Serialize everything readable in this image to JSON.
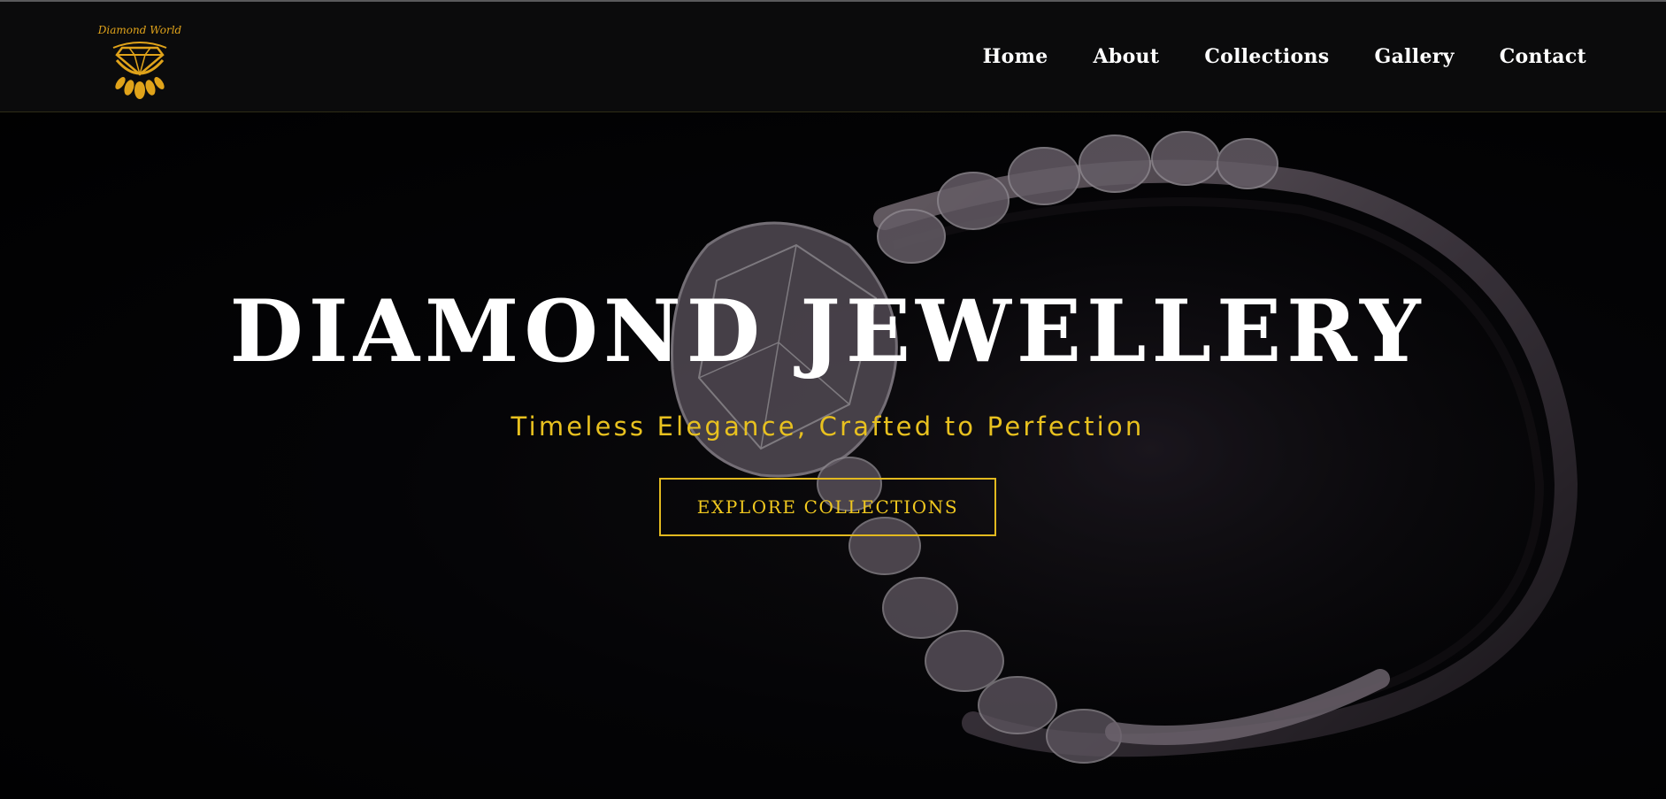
{
  "brand": {
    "logo_text": "Diamond World",
    "logo_icon": "diamond-lotus-icon",
    "logo_color": "#e0a31a"
  },
  "nav": {
    "items": [
      {
        "label": "Home"
      },
      {
        "label": "About"
      },
      {
        "label": "Collections"
      },
      {
        "label": "Gallery"
      },
      {
        "label": "Contact"
      }
    ]
  },
  "hero": {
    "title": "DIAMOND JEWELLERY",
    "subtitle": "Timeless Elegance, Crafted to Perfection",
    "cta_label": "EXPLORE COLLECTIONS",
    "background_image": "diamond-ring-photo"
  },
  "colors": {
    "accent": "#e8c11f",
    "background": "#0b0b0c",
    "text": "#ffffff"
  }
}
